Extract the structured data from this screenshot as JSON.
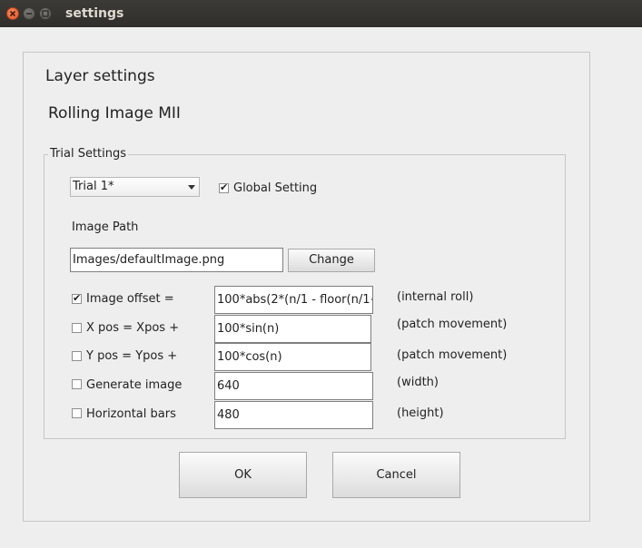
{
  "window": {
    "title": "settings"
  },
  "header": {
    "title": "Layer settings",
    "subtitle": "Rolling Image MII"
  },
  "trial_settings": {
    "group_label": "Trial Settings",
    "trial_select": {
      "value": "Trial 1*"
    },
    "global_setting": {
      "label": "Global Setting",
      "checked": true
    },
    "image_path": {
      "label": "Image Path",
      "value": "Images/defaultImage.png",
      "button": "Change"
    },
    "rows": [
      {
        "label": "Image offset =",
        "checked": true,
        "value": "100*abs(2*(n/1 - floor(n/1+",
        "note": "(internal roll)"
      },
      {
        "label": "X pos = Xpos +",
        "checked": false,
        "value": "100*sin(n)",
        "note": "(patch movement)"
      },
      {
        "label": "Y pos = Ypos +",
        "checked": false,
        "value": "100*cos(n)",
        "note": "(patch movement)"
      },
      {
        "label": "Generate image",
        "checked": false,
        "value": "640",
        "note": "(width)"
      },
      {
        "label": "Horizontal bars",
        "checked": false,
        "value": "480",
        "note": "(height)"
      }
    ]
  },
  "footer": {
    "ok": "OK",
    "cancel": "Cancel"
  }
}
